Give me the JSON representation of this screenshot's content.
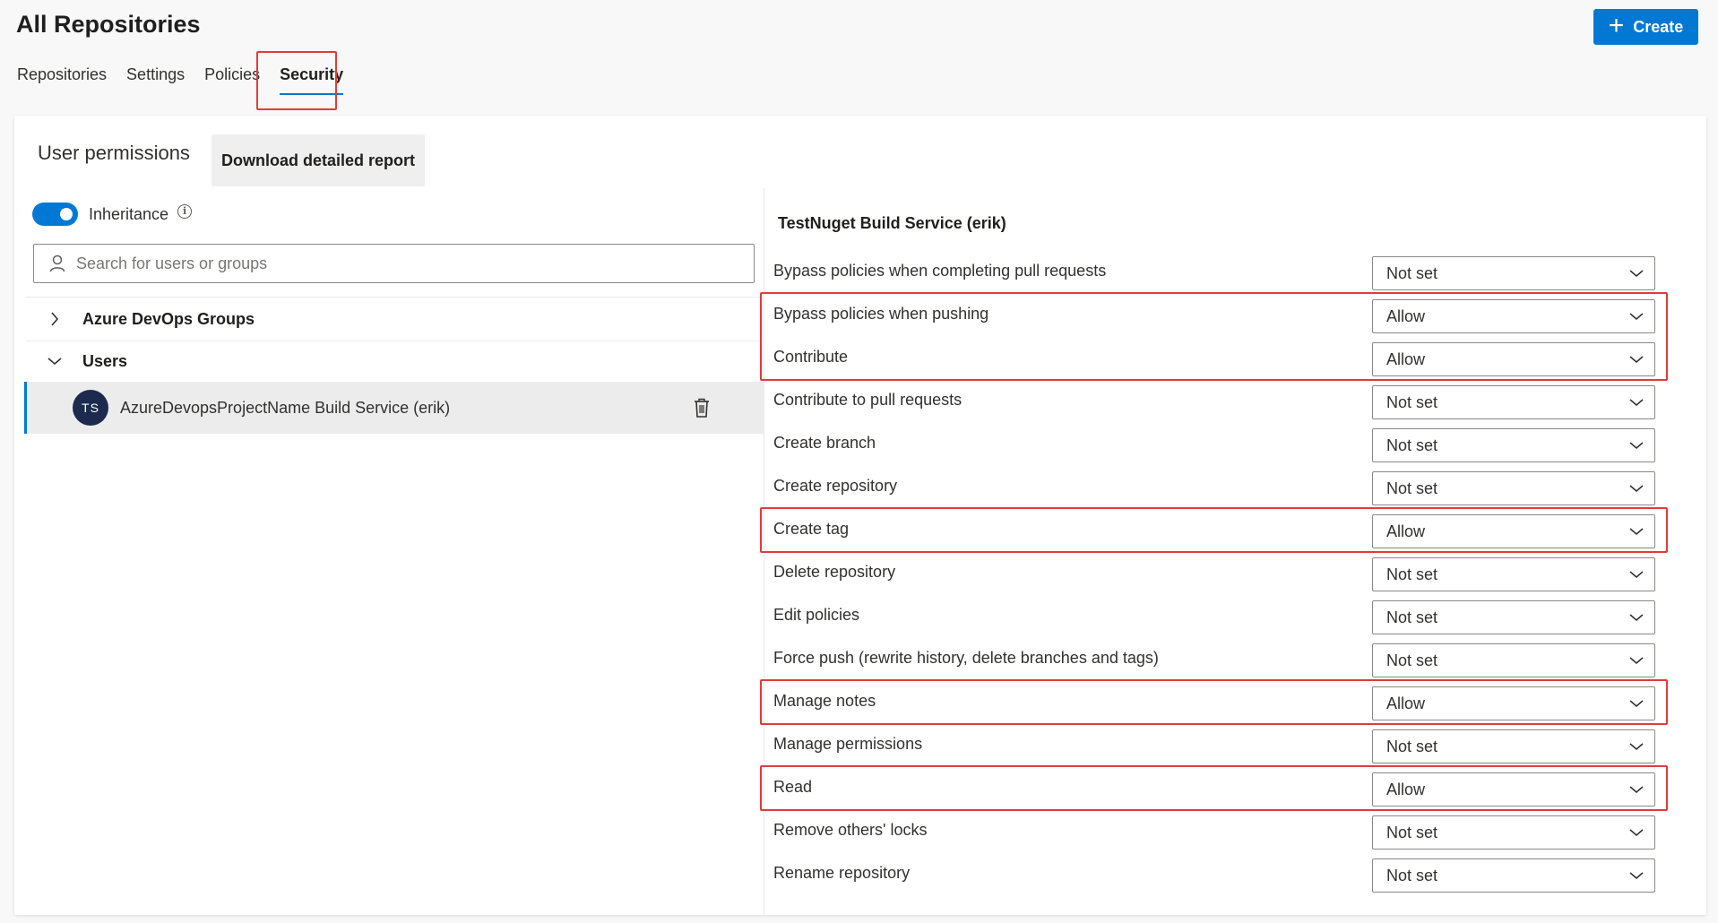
{
  "header": {
    "title": "All Repositories",
    "create_label": "Create"
  },
  "tabs": [
    {
      "label": "Repositories",
      "active": false
    },
    {
      "label": "Settings",
      "active": false
    },
    {
      "label": "Policies",
      "active": false
    },
    {
      "label": "Security",
      "active": true
    }
  ],
  "left_panel": {
    "heading": "User permissions",
    "download_label": "Download detailed report",
    "inheritance_label": "Inheritance",
    "inheritance_on": true,
    "search_placeholder": "Search for users or groups",
    "groups_label": "Azure DevOps Groups",
    "users_label": "Users",
    "selected_user": {
      "initials": "TS",
      "name": "AzureDevopsProjectName Build Service (erik)"
    }
  },
  "right_panel": {
    "identity_title": "TestNuget Build Service (erik)",
    "permissions": [
      {
        "label": "Bypass policies when completing pull requests",
        "value": "Not set"
      },
      {
        "label": "Bypass policies when pushing",
        "value": "Allow"
      },
      {
        "label": "Contribute",
        "value": "Allow"
      },
      {
        "label": "Contribute to pull requests",
        "value": "Not set"
      },
      {
        "label": "Create branch",
        "value": "Not set"
      },
      {
        "label": "Create repository",
        "value": "Not set"
      },
      {
        "label": "Create tag",
        "value": "Allow"
      },
      {
        "label": "Delete repository",
        "value": "Not set"
      },
      {
        "label": "Edit policies",
        "value": "Not set"
      },
      {
        "label": "Force push (rewrite history, delete branches and tags)",
        "value": "Not set"
      },
      {
        "label": "Manage notes",
        "value": "Allow"
      },
      {
        "label": "Manage permissions",
        "value": "Not set"
      },
      {
        "label": "Read",
        "value": "Allow"
      },
      {
        "label": "Remove others' locks",
        "value": "Not set"
      },
      {
        "label": "Rename repository",
        "value": "Not set"
      }
    ]
  },
  "colors": {
    "accent": "#0078d4",
    "highlight": "#e03c3c",
    "avatar": "#1b2a4e"
  }
}
